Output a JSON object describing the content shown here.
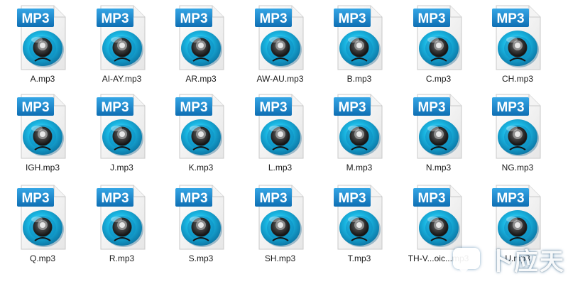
{
  "files": [
    {
      "name": "A.mp3"
    },
    {
      "name": "AI-AY.mp3"
    },
    {
      "name": "AR.mp3"
    },
    {
      "name": "AW-AU.mp3"
    },
    {
      "name": "B.mp3"
    },
    {
      "name": "C.mp3"
    },
    {
      "name": "CH.mp3"
    },
    {
      "name": "IGH.mp3"
    },
    {
      "name": "J.mp3"
    },
    {
      "name": "K.mp3"
    },
    {
      "name": "L.mp3"
    },
    {
      "name": "M.mp3"
    },
    {
      "name": "N.mp3"
    },
    {
      "name": "NG.mp3"
    },
    {
      "name": "Q.mp3"
    },
    {
      "name": "R.mp3"
    },
    {
      "name": "S.mp3"
    },
    {
      "name": "SH.mp3"
    },
    {
      "name": "T.mp3"
    },
    {
      "name": "TH-V...oic...mp3"
    },
    {
      "name": "U.mp3"
    }
  ],
  "icon": {
    "badge_text": "MP3",
    "name": "mp3-file-icon"
  },
  "watermark": {
    "text": "卜应天"
  },
  "colors": {
    "badge": "#1a86c8",
    "disc": "#12a9d6",
    "background": "#ffffff"
  }
}
